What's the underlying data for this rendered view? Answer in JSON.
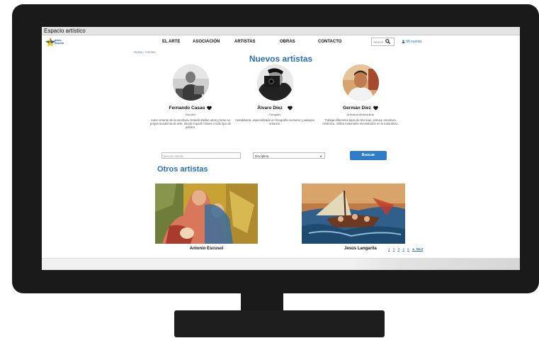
{
  "window": {
    "title": "Espacio artístico"
  },
  "logo": {
    "text": "artes Esceta"
  },
  "nav": {
    "items": [
      "EL ARTE",
      "ASOCIACIÓN",
      "ARTISTAS",
      "OBRAS",
      "CONTACTO"
    ]
  },
  "search": {
    "placeholder": "Search"
  },
  "account": {
    "label": "Mi cuenta"
  },
  "breadcrumb": {
    "home": "Home",
    "separator": "/",
    "current": "Artistas"
  },
  "new_artists": {
    "title": "Nuevos artistas",
    "artists": [
      {
        "name": "Fernando Casao",
        "role": "Escultor",
        "desc": "Autor amante de la escultura. Estudió Bellas artes y tiene su propia academia de arte, donde imparte clases a todo tipo de público."
      },
      {
        "name": "Álvaro Díez",
        "role": "Fotógrafo",
        "desc": "Autodidacta, especializado en fotografía nocturan y paisajes urbanos."
      },
      {
        "name": "Germán Díez",
        "role": "Artista multidisciplinar",
        "desc": "Trabaja diferentes tipos de técnicas, pintura, escultura, cerámica. Utiliza materiales encontrados en la naturaleza."
      }
    ]
  },
  "filters": {
    "search_placeholder": "Buscar artista",
    "discipline": "Disciplina",
    "button": "Buscar"
  },
  "other_artists": {
    "title": "Otros artistas",
    "cards": [
      {
        "name": "Antonio Escusol"
      },
      {
        "name": "Jesús Langarita"
      }
    ]
  },
  "pagination": {
    "pages": [
      "1",
      "2",
      "3",
      "4",
      "5"
    ],
    "next": "Next"
  },
  "colors": {
    "accent": "#2a6fbd",
    "button": "#2f7ccb",
    "bezel": "#1a1a1a"
  }
}
